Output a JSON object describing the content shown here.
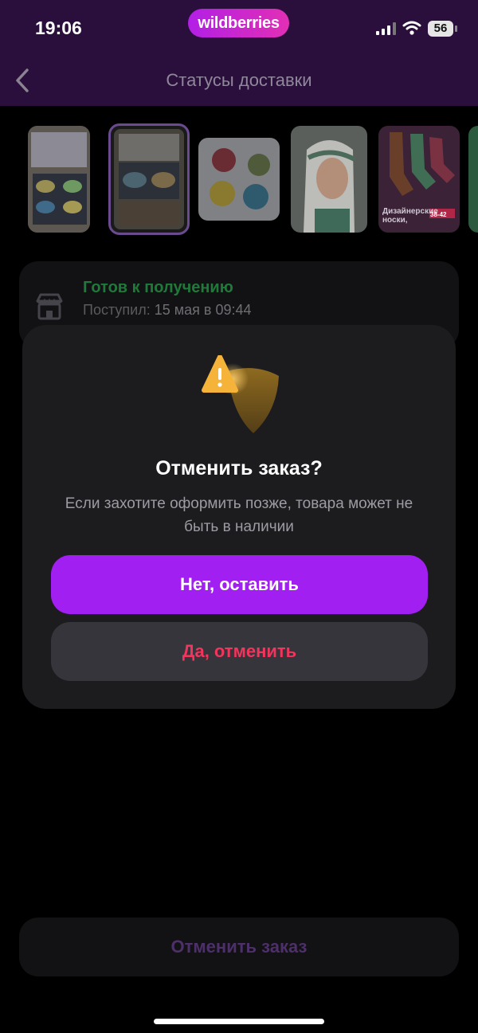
{
  "status_bar": {
    "time": "19:06",
    "brand": "wildberries",
    "battery": "56"
  },
  "nav": {
    "title": "Статусы доставки",
    "back_icon": "chevron-left-icon"
  },
  "thumbnails": [
    "bowls-set-box",
    "bowls-set-box-selected",
    "bowls-four",
    "headscarf-model",
    "designer-socks",
    "product-partial"
  ],
  "sock_promo": {
    "line1": "Дизайнерские",
    "line2": "носки,",
    "size": "38-42"
  },
  "order_status": {
    "state": "Готов к получению",
    "arrived_label": "Поступил:",
    "arrived_value": "15 мая в 09:44",
    "icon": "store-icon"
  },
  "dialog": {
    "icon": "warning-shield-icon",
    "title": "Отменить заказ?",
    "text": "Если захотите оформить позже, товара может не быть в наличии",
    "confirm_keep": "Нет, оставить",
    "confirm_cancel": "Да, отменить"
  },
  "footer": {
    "cancel_order": "Отменить заказ"
  },
  "colors": {
    "accent": "#a11ff0",
    "danger": "#f2355c",
    "success": "#1f7a3a",
    "header_bg": "#2a0f3c"
  }
}
